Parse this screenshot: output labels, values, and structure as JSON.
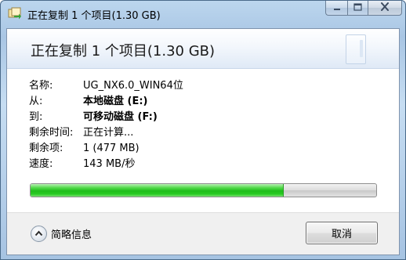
{
  "window": {
    "title": "正在复制 1 个项目(1.30 GB)",
    "icon": "copy-files-icon",
    "controls": {
      "minimize_icon": "minimize-icon",
      "maximize_icon": "maximize-icon",
      "close_icon": "close-icon"
    }
  },
  "header": {
    "title": "正在复制 1 个项目(1.30 GB)"
  },
  "details": {
    "name_label": "名称:",
    "name_value": "UG_NX6.0_WIN64位",
    "from_label": "从:",
    "from_value": "本地磁盘 (E:)",
    "to_label": "到:",
    "to_value": "可移动磁盘 (F:)",
    "time_left_label": "剩余时间:",
    "time_left_value": "正在计算...",
    "items_left_label": "剩余项:",
    "items_left_value": "1 (477 MB)",
    "speed_label": "速度:",
    "speed_value": "143 MB/秒"
  },
  "progress": {
    "fraction": 0.73,
    "color": "#22c41c"
  },
  "footer": {
    "details_toggle_label": "简略信息",
    "details_toggle_icon": "chevron-up-icon",
    "cancel_label": "取消"
  }
}
